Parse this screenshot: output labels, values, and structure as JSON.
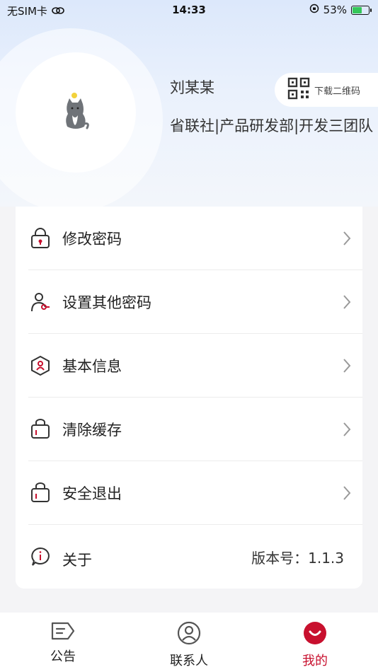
{
  "status_bar": {
    "carrier": "无SIM卡",
    "time": "14:33",
    "battery_percent": "53%",
    "battery_level": 0.53
  },
  "profile": {
    "name": "刘某某",
    "department": "省联社|产品研发部|开发三团队",
    "avatar_icon": "cat-avatar-icon"
  },
  "qr": {
    "label": "下载二维码"
  },
  "menu": {
    "items": [
      {
        "label": "修改密码",
        "icon": "lock-icon"
      },
      {
        "label": "设置其他密码",
        "icon": "user-key-icon"
      },
      {
        "label": "基本信息",
        "icon": "profile-hex-icon"
      },
      {
        "label": "清除缓存",
        "icon": "bin-icon"
      },
      {
        "label": "安全退出",
        "icon": "exit-icon"
      },
      {
        "label": "关于",
        "icon": "info-bubble-icon",
        "version": "版本号：1.1.3"
      }
    ]
  },
  "tabbar": {
    "tabs": [
      {
        "label": "公告",
        "icon": "notice-icon"
      },
      {
        "label": "联系人",
        "icon": "contacts-icon"
      },
      {
        "label": "我的",
        "icon": "me-icon",
        "active": true
      }
    ]
  },
  "colors": {
    "accent": "#c8102e",
    "header_gradient_top": "#dce8fb"
  }
}
